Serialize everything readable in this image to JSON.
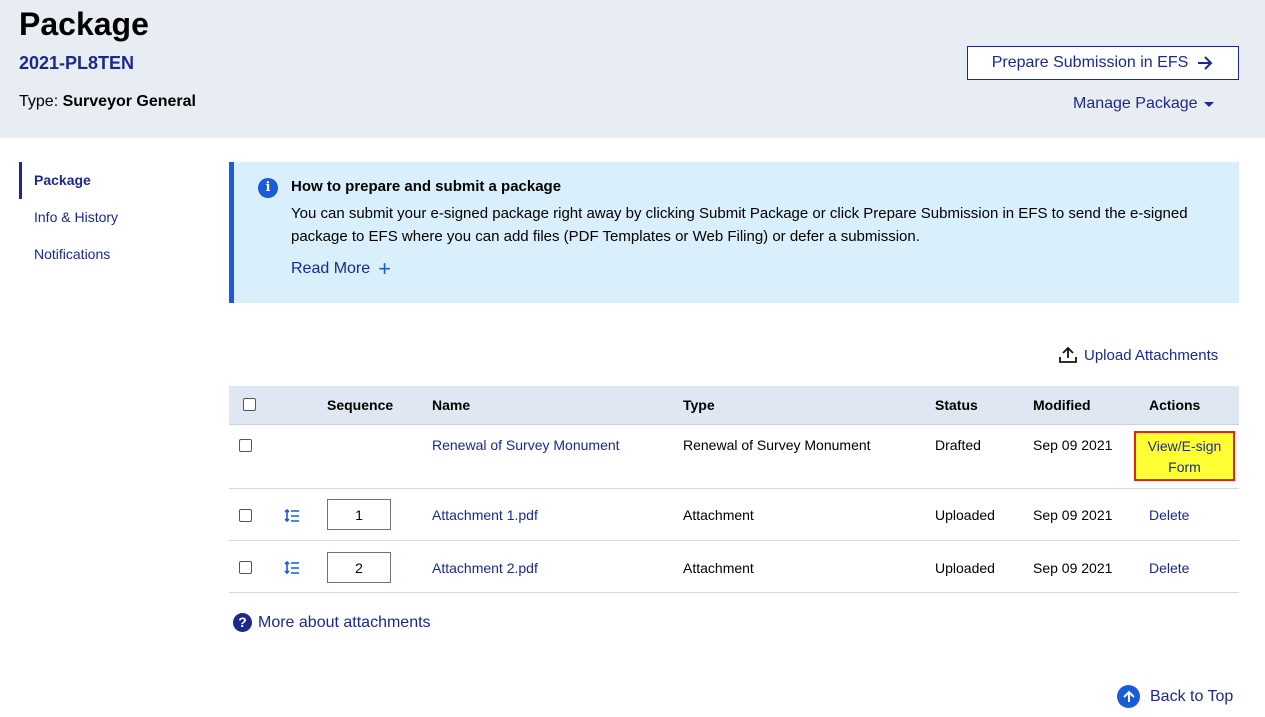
{
  "header": {
    "title": "Package",
    "package_id": "2021-PL8TEN",
    "type_label": "Type:",
    "type_value": "Surveyor General",
    "prepare_button": "Prepare Submission in EFS",
    "manage_menu": "Manage Package"
  },
  "sidenav": {
    "items": [
      {
        "label": "Package"
      },
      {
        "label": "Info & History"
      },
      {
        "label": "Notifications"
      }
    ]
  },
  "info": {
    "title": "How to prepare and submit a package",
    "text": "You can submit your e-signed package right away by clicking Submit Package or click Prepare Submission in EFS to send the e-signed package to EFS where you can add files (PDF Templates or Web Filing) or defer a submission.",
    "read_more": "Read More",
    "icon": "info-icon"
  },
  "upload_label": "Upload Attachments",
  "table": {
    "columns": [
      "Sequence",
      "Name",
      "Type",
      "Status",
      "Modified",
      "Actions"
    ],
    "rows": [
      {
        "sequence": "",
        "name": "Renewal of Survey Monument",
        "type": "Renewal of Survey Monument",
        "status": "Drafted",
        "modified": "Sep 09 2021",
        "action": "View/E-sign Form"
      },
      {
        "sequence": "1",
        "name": "Attachment 1.pdf",
        "type": "Attachment",
        "status": "Uploaded",
        "modified": "Sep 09 2021",
        "action": "Delete"
      },
      {
        "sequence": "2",
        "name": "Attachment 2.pdf",
        "type": "Attachment",
        "status": "Uploaded",
        "modified": "Sep 09 2021",
        "action": "Delete"
      }
    ]
  },
  "more_about": "More about attachments",
  "back_to_top": "Back to Top",
  "colors": {
    "brand": "#1b2a8a",
    "accent": "#1a5bd8",
    "header_bg": "#e8edf4",
    "info_bg": "#d9effb",
    "highlight": "#ffff33",
    "highlight_border": "#e2231a"
  }
}
